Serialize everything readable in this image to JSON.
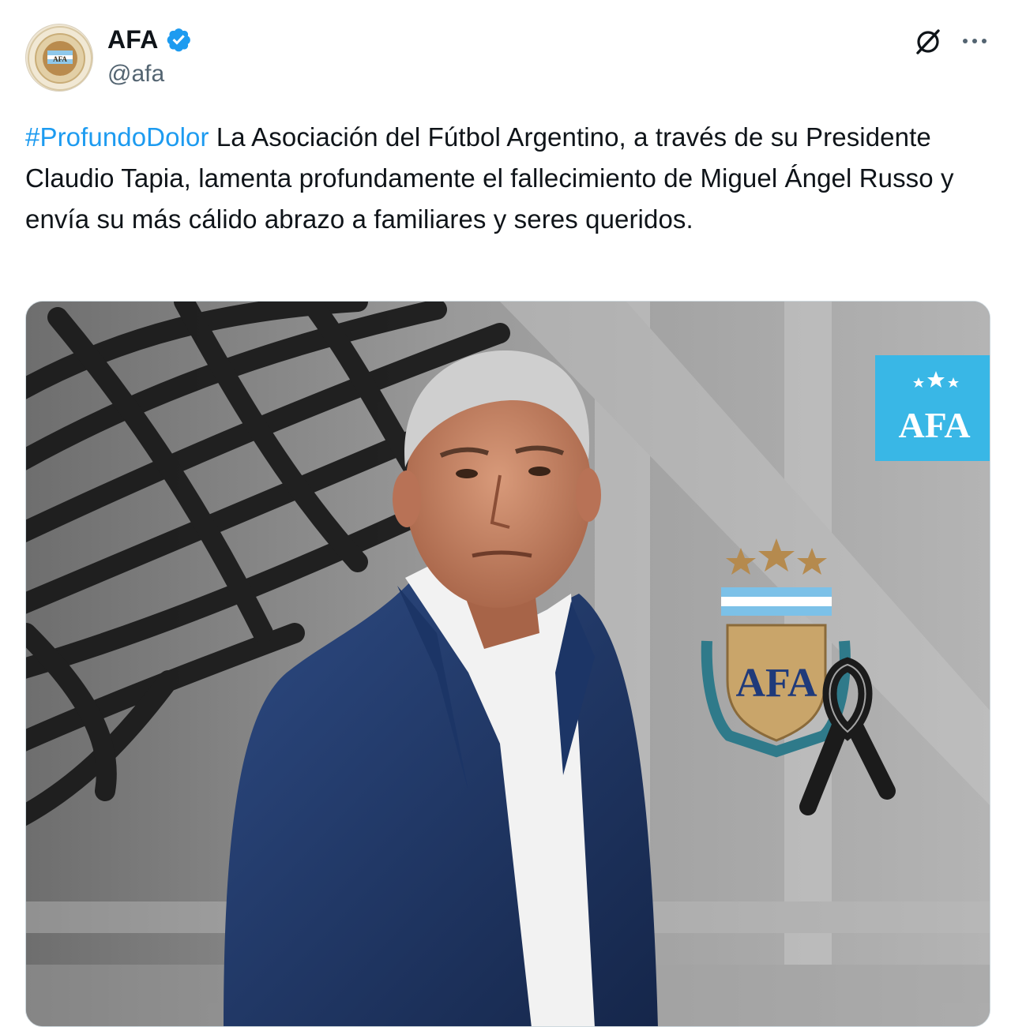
{
  "account": {
    "display_name": "AFA",
    "handle": "@afa",
    "verified": true,
    "avatar": "afa-crest-avatar"
  },
  "tweet": {
    "hashtag": "#ProfundoDolor",
    "body": " La Asociación del Fútbol Argentino, a través de su Presidente Claudio Tapia, lamenta profundamente el fallecimiento de Miguel Ángel Russo y envía su más cálido abrazo a familiares y seres queridos."
  },
  "media": {
    "badge_text": "AFA",
    "crest_text": "AFA",
    "image": "mourning-photo"
  },
  "icons": {
    "grok": "grok-icon",
    "more": "more-icon",
    "verified": "verified-badge-icon"
  },
  "colors": {
    "link": "#1d9bf0",
    "verified": "#1d9bf0",
    "text": "#0f1419",
    "secondary": "#536471",
    "badge_bg": "#39b7e6"
  }
}
